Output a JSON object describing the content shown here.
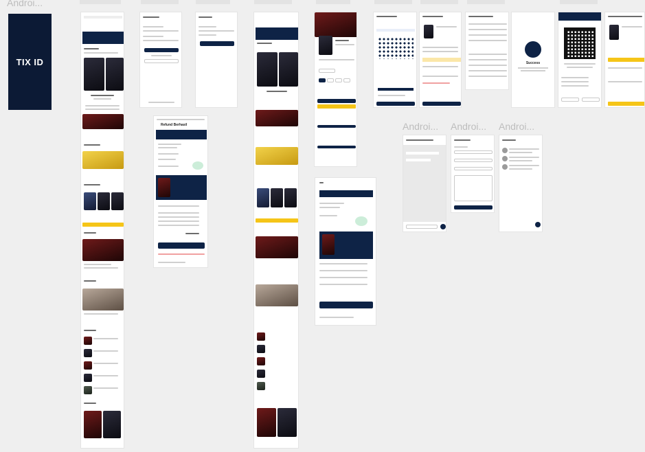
{
  "canvas": {
    "frame_labels": [
      "Androi...",
      "Androi...",
      "Androi..."
    ],
    "top_label": "Androi..."
  },
  "logo": {
    "text": "TIX ID"
  },
  "refund": {
    "title": "Refund Berhasil"
  },
  "success": {
    "title": "Success"
  },
  "colors": {
    "navy": "#0e2346",
    "yellow": "#f5c518",
    "canvas": "#efefef"
  }
}
